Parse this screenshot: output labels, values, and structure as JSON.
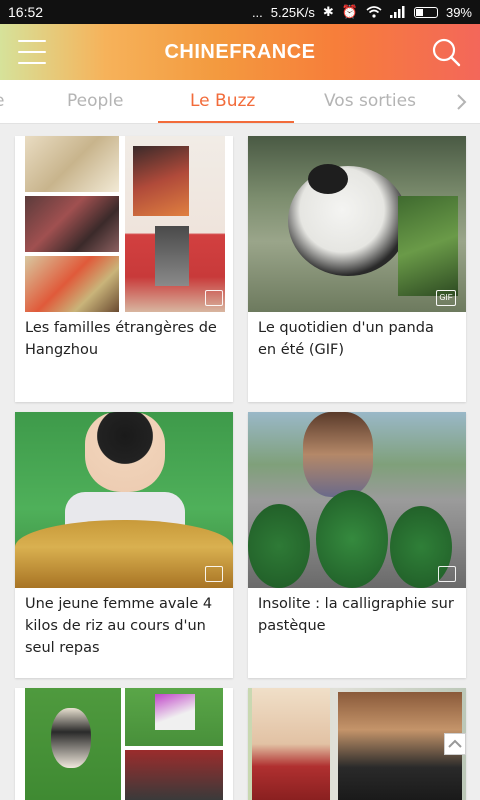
{
  "status_bar": {
    "time": "16:52",
    "signal_dots": "...",
    "net_speed": "5.25K/s",
    "battery": "39%",
    "battery_level": 0.39
  },
  "app_bar": {
    "title": "CHINEFRANCE",
    "menu_icon": "hamburger-menu-icon",
    "search_icon": "search-icon"
  },
  "tabs": {
    "items": [
      "e",
      "People",
      "Le Buzz",
      "Vos sorties"
    ],
    "active": "Le Buzz",
    "more_icon": "chevron-right-icon",
    "accent_color": "#f26b3a"
  },
  "cards": [
    {
      "title": "Les familles étrangères de Hangzhou",
      "badge": "image-gallery-icon"
    },
    {
      "title": "Le quotidien d'un panda en été (GIF)",
      "badge": "GIF"
    },
    {
      "title": "Une jeune femme avale 4 kilos de riz au cours d'un seul repas",
      "badge": "image-gallery-icon"
    },
    {
      "title": "Insolite : la calligraphie sur pastèque",
      "badge": "image-gallery-icon"
    },
    {
      "title": "",
      "badge": ""
    },
    {
      "title": "",
      "badge": ""
    }
  ]
}
